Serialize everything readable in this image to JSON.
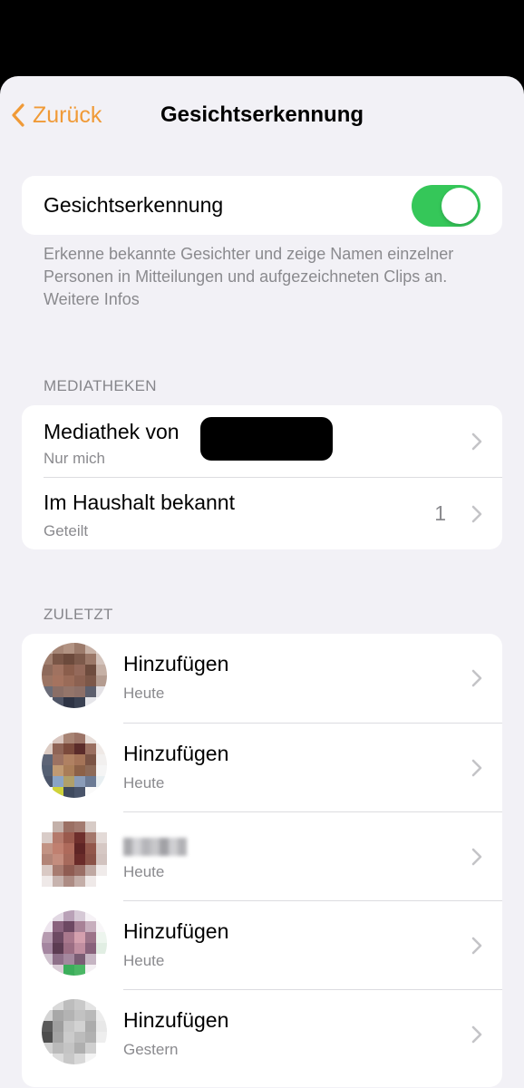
{
  "nav": {
    "back_label": "Zurück",
    "title": "Gesichtserkennung"
  },
  "toggle": {
    "label": "Gesichtserkennung",
    "state": "on"
  },
  "footer": {
    "text": "Erkenne bekannte Gesichter und zeige Namen einzelner Personen in Mitteilungen und aufgezeichneten Clips an.",
    "link": "Weitere Infos"
  },
  "libraries": {
    "header": "MEDIATHEKEN",
    "items": [
      {
        "title": "Mediathek von",
        "subtitle": "Nur mich"
      },
      {
        "title": "Im Haushalt bekannt",
        "subtitle": "Geteilt",
        "count": "1"
      }
    ]
  },
  "recent": {
    "header": "ZULETZT",
    "items": [
      {
        "title": "Hinzufügen",
        "subtitle": "Heute"
      },
      {
        "title": "Hinzufügen",
        "subtitle": "Heute"
      },
      {
        "title": "",
        "subtitle": "Heute"
      },
      {
        "title": "Hinzufügen",
        "subtitle": "Heute"
      },
      {
        "title": "Hinzufügen",
        "subtitle": "Gestern"
      }
    ]
  },
  "colors": {
    "accent": "#f09a37",
    "toggle_on": "#35c759",
    "background": "#f2f1f6"
  }
}
